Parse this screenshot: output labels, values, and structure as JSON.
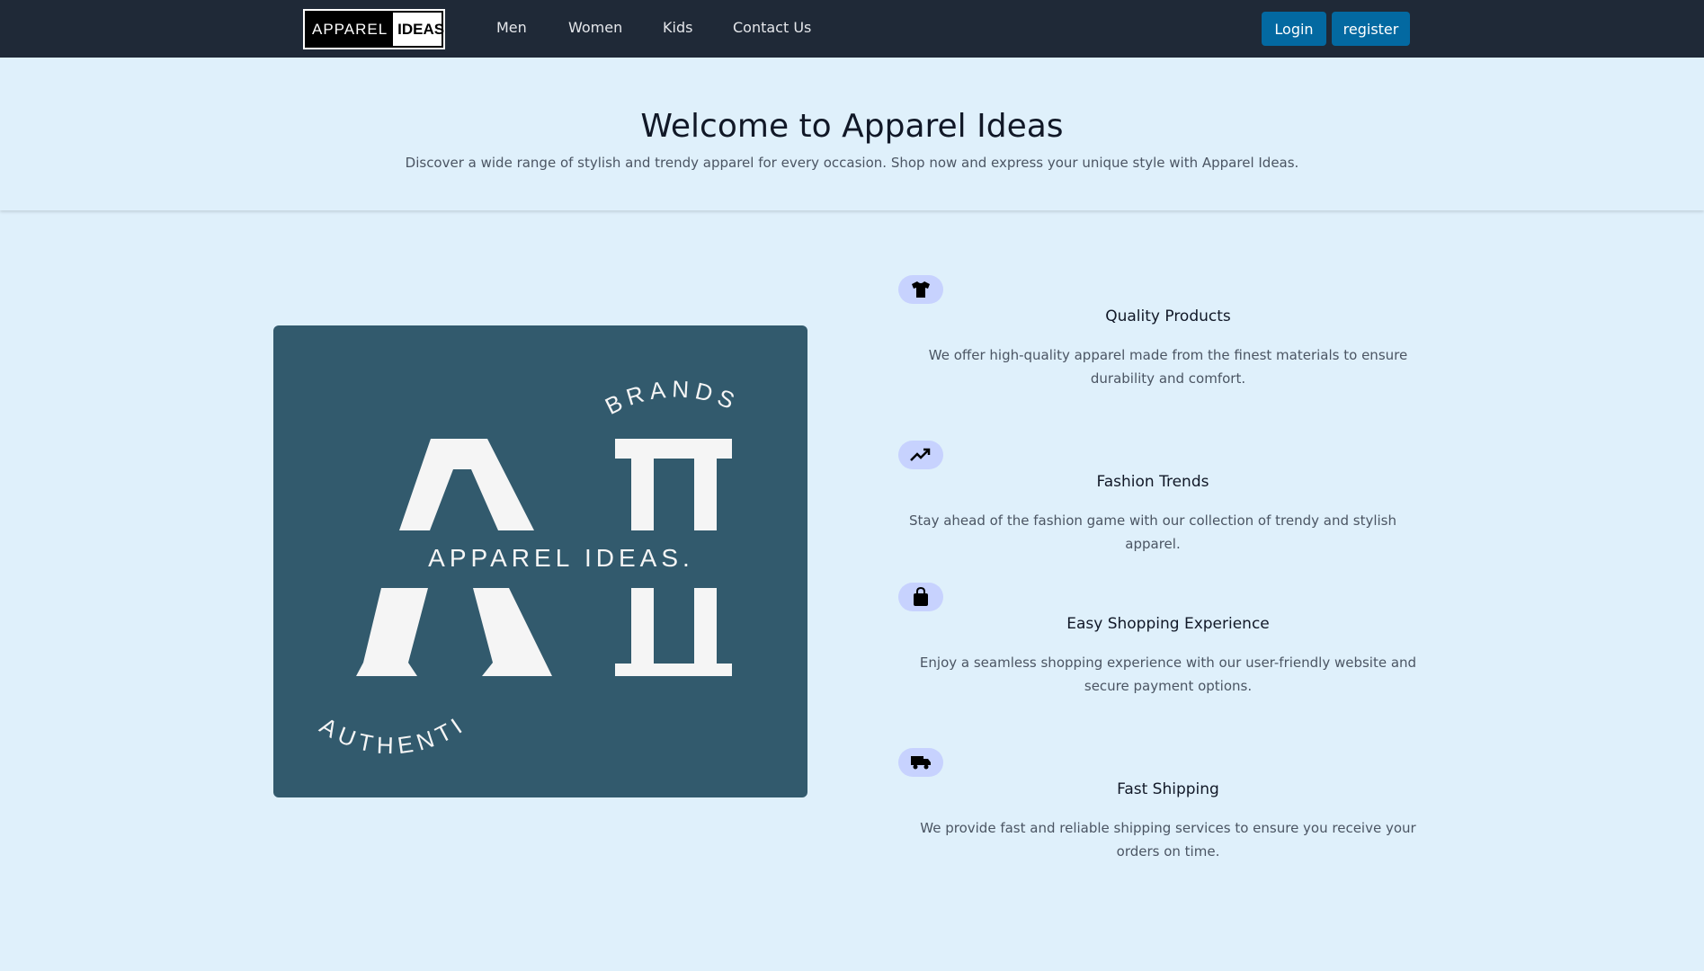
{
  "nav": {
    "logo_left": "APPAREL",
    "logo_right": "IDEAS",
    "links": [
      "Men",
      "Women",
      "Kids",
      "Contact Us"
    ],
    "login_label": "Login",
    "register_label": "register"
  },
  "hero": {
    "title": "Welcome to Apparel Ideas",
    "subtitle": "Discover a wide range of stylish and trendy apparel for every occasion. Shop now and express your unique style with Apparel Ideas."
  },
  "brand_image": {
    "top_text": "BRANDS",
    "center_text": "APPAREL IDEAS.",
    "bottom_text": "AUTHENTIC",
    "monogram": "AI"
  },
  "features": [
    {
      "icon": "shirt-icon",
      "title": "Quality Products",
      "desc": "We offer high-quality apparel made from the finest materials to ensure durability and comfort."
    },
    {
      "icon": "trending-up-icon",
      "title": "Fashion Trends",
      "desc": "Stay ahead of the fashion game with our collection of trendy and stylish apparel."
    },
    {
      "icon": "shopping-bag-icon",
      "title": "Easy Shopping Experience",
      "desc": "Enjoy a seamless shopping experience with our user-friendly website and secure payment options."
    },
    {
      "icon": "truck-icon",
      "title": "Fast Shipping",
      "desc": "We provide fast and reliable shipping services to ensure you receive your orders on time."
    }
  ],
  "colors": {
    "navbar": "#1f2937",
    "page_bg": "#dff0fb",
    "button": "#0369a1",
    "brand_bg": "#325a6d",
    "icon_pill": "#c7d2fe"
  }
}
